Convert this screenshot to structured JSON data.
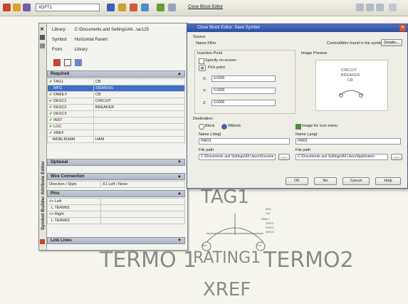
{
  "toolbar": {
    "block_combo_value": "XDFT1",
    "close_block_editor": "Close Block Editor"
  },
  "palette": {
    "title": "Symbol Builder Attribute Editor",
    "library_label": "Library:",
    "library_value": "C:\\Documents and Settings\\All...\\ac125",
    "symbol_label": "Symbol:",
    "symbol_value": "Horizontal Parent",
    "from_label": "From:",
    "from_value": "Library",
    "required": {
      "header": "Required",
      "rows": [
        {
          "name": "TAG1",
          "value": "CB"
        },
        {
          "name": "MFG",
          "value": "SIEMENS"
        },
        {
          "name": "FAMILY",
          "value": "CB"
        },
        {
          "name": "DESC1",
          "value": "CIRCUIT"
        },
        {
          "name": "DESC2",
          "value": "BREAKER"
        },
        {
          "name": "DESC3",
          "value": ""
        },
        {
          "name": "INST",
          "value": ""
        },
        {
          "name": "LOC",
          "value": ""
        },
        {
          "name": "XREF",
          "value": ""
        },
        {
          "name": "WDBLKNAM",
          "value": "HAM"
        }
      ]
    },
    "optional_header": "Optional",
    "wire_connection": {
      "header": "Wire Connection",
      "direction_label": "Direction / Style",
      "direction_value": "X1 Left / None"
    },
    "pins": {
      "header": "Pins",
      "items": [
        "Left",
        "TERM01",
        "Right",
        "TERM02"
      ]
    },
    "link_lines_header": "Link Lines"
  },
  "dialog": {
    "title": "Close Block Editor: Save Symbol",
    "symbol_group": "Source",
    "name_label": "Name:",
    "name_value": "XRm",
    "control_label": "Control/Attrs found in the symbol",
    "details_button": "Details...",
    "insertion_group": "Insertion Point",
    "specify_onscreen": "Specify on-screen",
    "pick_point": "Pick point",
    "x_label": "X:",
    "x_value": "0.0000",
    "y_label": "Y:",
    "y_value": "0.0000",
    "z_label": "Z:",
    "z_value": "0.0000",
    "preview_group": "Image Preview",
    "preview_lines": [
      "CIRCUIT",
      "BREAKER",
      "CB"
    ],
    "destination_group": "Destination",
    "block_label": "Block",
    "wblock_label": "Wblock",
    "image_menu_label": "Image for icon menu",
    "block_name_label": "Name (.dwg)",
    "block_name_value": "HWO1",
    "image_name_label": "Name (.png)",
    "image_name_value": "HW01",
    "file_path_label": "File path",
    "file_path_value": "C:\\Documents and Settings\\All Users\\Docume",
    "image_path_label": "File path",
    "image_path_value": "C:\\Documents and Settings\\All Users\\Application",
    "browse": "...",
    "ok": "OK",
    "no": "No",
    "cancel": "Cancel",
    "help": "Help"
  },
  "drawing": {
    "tag": "TAG1",
    "term1": "TERMO 1",
    "rating": "RATING1",
    "term2": "TERMO2",
    "xref": "XREF",
    "small": [
      "MFG",
      "CAT",
      "FAMILY",
      "DESC1",
      "DESC2",
      "DESC3",
      "INST",
      "LOC"
    ]
  },
  "colors": {
    "accent": "#2b4f9e",
    "check": "#3a9a2a",
    "drawing_text": "#8a8a8a"
  }
}
